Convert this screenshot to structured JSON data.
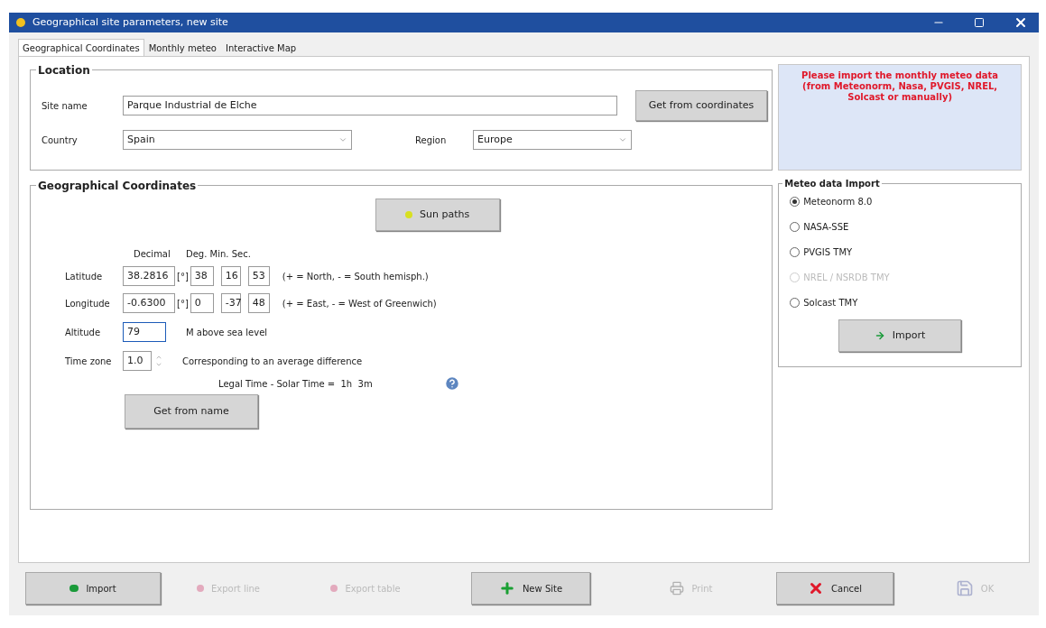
{
  "window": {
    "title": "Geographical site parameters, new site"
  },
  "tabs": [
    {
      "label": "Geographical Coordinates",
      "selected": true
    },
    {
      "label": "Monthly meteo",
      "selected": false
    },
    {
      "label": "Interactive Map",
      "selected": false
    }
  ],
  "location": {
    "title": "Location",
    "site_name_label": "Site name",
    "site_name": "Parque Industrial de Elche",
    "get_button": "Get from coordinates",
    "country_label": "Country",
    "country": "Spain",
    "region_label": "Region",
    "region": "Europe"
  },
  "notice": "Please import the monthly meteo data (from Meteonorm, Nasa, PVGIS, NREL, Solcast or manually)",
  "coordinates": {
    "title": "Geographical Coordinates",
    "sun_paths": "Sun paths",
    "decimal_header": "Decimal",
    "dms_header": "Deg. Min. Sec.",
    "rows": [
      {
        "label": "Latitude",
        "decimal": "38.2816",
        "unit": "[°]",
        "deg": "38",
        "min": "16",
        "sec": "53",
        "note": "(+ = North, - = South hemisph.)"
      },
      {
        "label": "Longitude",
        "decimal": "-0.6300",
        "unit": "[°]",
        "deg": "0",
        "min": "-37",
        "sec": "48",
        "note": "(+ = East, - = West of Greenwich)"
      }
    ],
    "altitude": {
      "label": "Altitude",
      "value": "79",
      "note": "M above sea level",
      "focused": true
    },
    "timezone": {
      "label": "Time zone",
      "value": "1.0",
      "note": "Corresponding to an average difference"
    },
    "legal_time": "Legal Time - Solar Time =  1h  3m",
    "get_from_name": "Get from name"
  },
  "meteo": {
    "title": "Meteo data Import",
    "options": [
      {
        "label": "Meteonorm 8.0",
        "selected": true,
        "disabled": false
      },
      {
        "label": "NASA-SSE",
        "selected": false,
        "disabled": false
      },
      {
        "label": "PVGIS TMY",
        "selected": false,
        "disabled": false
      },
      {
        "label": "NREL / NSRDB TMY",
        "selected": false,
        "disabled": true
      },
      {
        "label": "Solcast TMY",
        "selected": false,
        "disabled": false
      }
    ],
    "import": "Import"
  },
  "footer": [
    {
      "kind": "import",
      "label": "Import",
      "disabled": false
    },
    {
      "kind": "export",
      "label": "Export line",
      "disabled": true
    },
    {
      "kind": "export",
      "label": "Export table",
      "disabled": true
    },
    {
      "kind": "new",
      "label": "New Site",
      "disabled": false
    },
    {
      "kind": "print",
      "label": "Print",
      "disabled": true
    },
    {
      "kind": "cancel",
      "label": "Cancel",
      "disabled": false
    },
    {
      "kind": "ok",
      "label": "OK",
      "disabled": true
    }
  ]
}
